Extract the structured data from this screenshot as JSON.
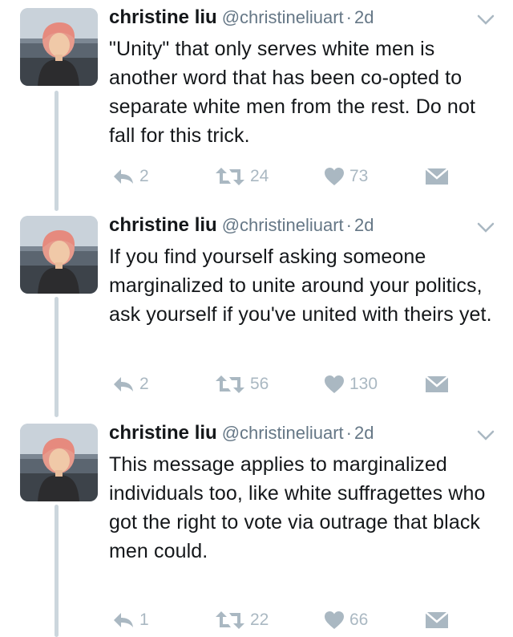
{
  "tweets": [
    {
      "name": "christine liu",
      "handle": "@christineliuart",
      "separator": "·",
      "time": "2d",
      "text": "\"Unity\" that only serves white men is another word that has been co-opted to separate white men from the rest. Do not fall for this trick.",
      "replies": "2",
      "retweets": "24",
      "likes": "73"
    },
    {
      "name": "christine liu",
      "handle": "@christineliuart",
      "separator": "·",
      "time": "2d",
      "text": "If you find yourself asking someone marginalized to unite around your politics, ask yourself if you've united with theirs yet.",
      "replies": "2",
      "retweets": "56",
      "likes": "130"
    },
    {
      "name": "christine liu",
      "handle": "@christineliuart",
      "separator": "·",
      "time": "2d",
      "text": "This message applies to marginalized individuals too, like white suffragettes who got the right to vote via outrage that black men could.",
      "replies": "1",
      "retweets": "22",
      "likes": "66"
    }
  ],
  "icons": {
    "reply": "reply-icon",
    "retweet": "retweet-icon",
    "like": "heart-icon",
    "dm": "envelope-icon",
    "menu": "chevron-down-icon"
  },
  "colors": {
    "icon_gray": "#aab8c2",
    "meta_gray": "#657786",
    "text": "#14171a",
    "thread_line": "#ccd6dd"
  }
}
